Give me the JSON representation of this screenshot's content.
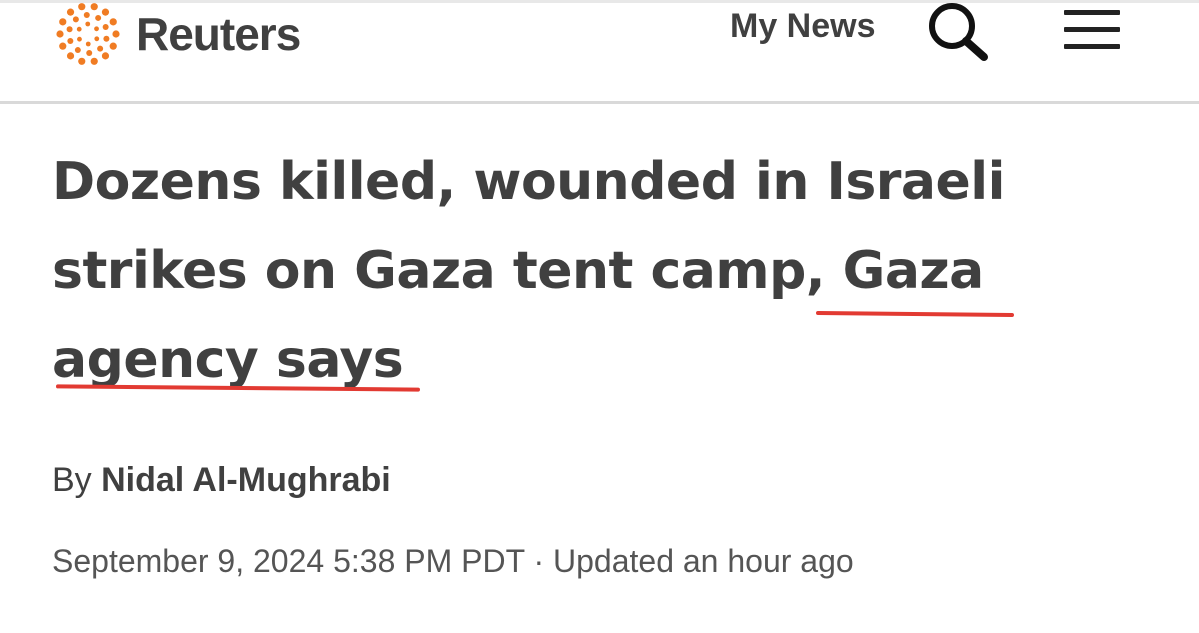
{
  "header": {
    "logo_text": "Reuters",
    "my_news_label": "My News",
    "search_icon": "search-icon",
    "menu_icon": "hamburger-menu-icon",
    "brand_color": "#f07c23"
  },
  "article": {
    "headline": "Dozens killed, wounded in Israeli strikes on Gaza tent camp, Gaza agency says",
    "byline_prefix": "By ",
    "author": "Nidal Al-Mughrabi",
    "published": "September 9, 2024 5:38 PM PDT",
    "separator": " · ",
    "updated": "Updated an hour ago",
    "underline_color": "#e23a32"
  }
}
